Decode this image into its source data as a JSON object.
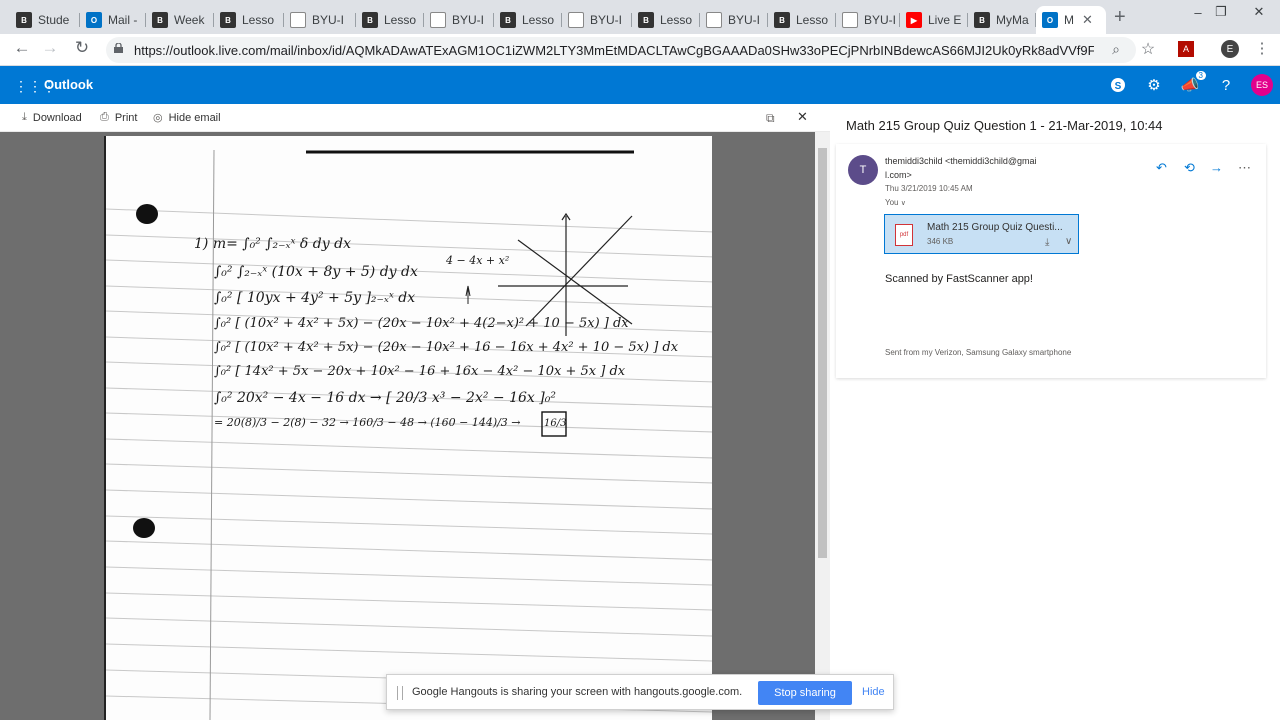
{
  "browser": {
    "tabs": [
      {
        "label": "Stude",
        "icon": "byu-icon",
        "color": "#333333"
      },
      {
        "label": "Mail -",
        "icon": "outlook-icon",
        "color": "#0072c6"
      },
      {
        "label": "Week",
        "icon": "byu-icon",
        "color": "#333333"
      },
      {
        "label": "Lesso",
        "icon": "byu-icon",
        "color": "#333333"
      },
      {
        "label": "BYU-I",
        "icon": "document-icon",
        "color": "#888888"
      },
      {
        "label": "Lesso",
        "icon": "byu-icon",
        "color": "#333333"
      },
      {
        "label": "BYU-I",
        "icon": "document-icon",
        "color": "#888888"
      },
      {
        "label": "Lesso",
        "icon": "byu-icon",
        "color": "#333333"
      },
      {
        "label": "BYU-I",
        "icon": "document-icon",
        "color": "#888888"
      },
      {
        "label": "Lesso",
        "icon": "byu-icon",
        "color": "#333333"
      },
      {
        "label": "BYU-I",
        "icon": "document-icon",
        "color": "#888888"
      },
      {
        "label": "Lesso",
        "icon": "byu-icon",
        "color": "#333333"
      },
      {
        "label": "BYU-I",
        "icon": "document-icon",
        "color": "#888888"
      },
      {
        "label": "Live E",
        "icon": "youtube-icon",
        "color": "#ff0000"
      },
      {
        "label": "MyMa",
        "icon": "byu-icon",
        "color": "#333333"
      },
      {
        "label": "M",
        "icon": "outlook-icon",
        "color": "#0072c6",
        "active": true
      }
    ],
    "url": "https://outlook.live.com/mail/inbox/id/AQMkADAwATExAGM1OC1iZWM2LTY3MmEtMDACLTAwCgBGAAADa0SHw33oPECjPNrbINBdewcAS66MJI2Uk0yRk8adVVf9F...",
    "profile_initial": "E"
  },
  "outlook": {
    "brand": "Outlook",
    "notification_count": "3",
    "user_initials": "ES",
    "accent": "#0078d4"
  },
  "viewer": {
    "download_label": "Download",
    "print_label": "Print",
    "hide_label": "Hide email"
  },
  "email": {
    "subject": "Math 215 Group Quiz Question 1 - 21-Mar-2019, 10:44",
    "sender_initial": "T",
    "sender_line1": "themiddi3child <themiddi3child@gmai",
    "sender_line2": "l.com>",
    "date": "Thu 3/21/2019 10:45 AM",
    "to": "You",
    "attachment_name": "Math 215 Group Quiz Questi...",
    "attachment_size": "346 KB",
    "body": "Scanned by FastScanner app!",
    "signature": "Sent from my Verizon, Samsung Galaxy smartphone"
  },
  "handwriting": {
    "line0": "1) m= ∫₀² ∫₂₋ₓˣ δ dy dx",
    "line1": "∫₀² ∫₂₋ₓˣ (10x + 8y + 5) dy dx",
    "note": "4 − 4x + x²",
    "line2": "∫₀² [ 10yx + 4y² + 5y ]₂₋ₓˣ dx",
    "line3": "∫₀² [ (10x² + 4x² + 5x) − (20x − 10x² + 4(2−x)² + 10 − 5x) ] dx",
    "line4": "∫₀² [ (10x² + 4x² + 5x) − (20x − 10x² + 16 − 16x + 4x² + 10 − 5x) ] dx",
    "line5": "∫₀² [ 14x² + 5x − 20x + 10x² − 16 + 16x − 4x² − 10x + 5x ] dx",
    "line6": "∫₀² 20x² − 4x − 16 dx → [ 20/3 x³ − 2x² − 16x ]₀²",
    "line7": "= 20(8)/3 − 2(8) − 32 → 160/3 − 48 → (160 − 144)/3 →",
    "answer": "16/3"
  },
  "hangouts": {
    "message": "Google Hangouts is sharing your screen with hangouts.google.com.",
    "stop_label": "Stop sharing",
    "hide_label": "Hide"
  }
}
